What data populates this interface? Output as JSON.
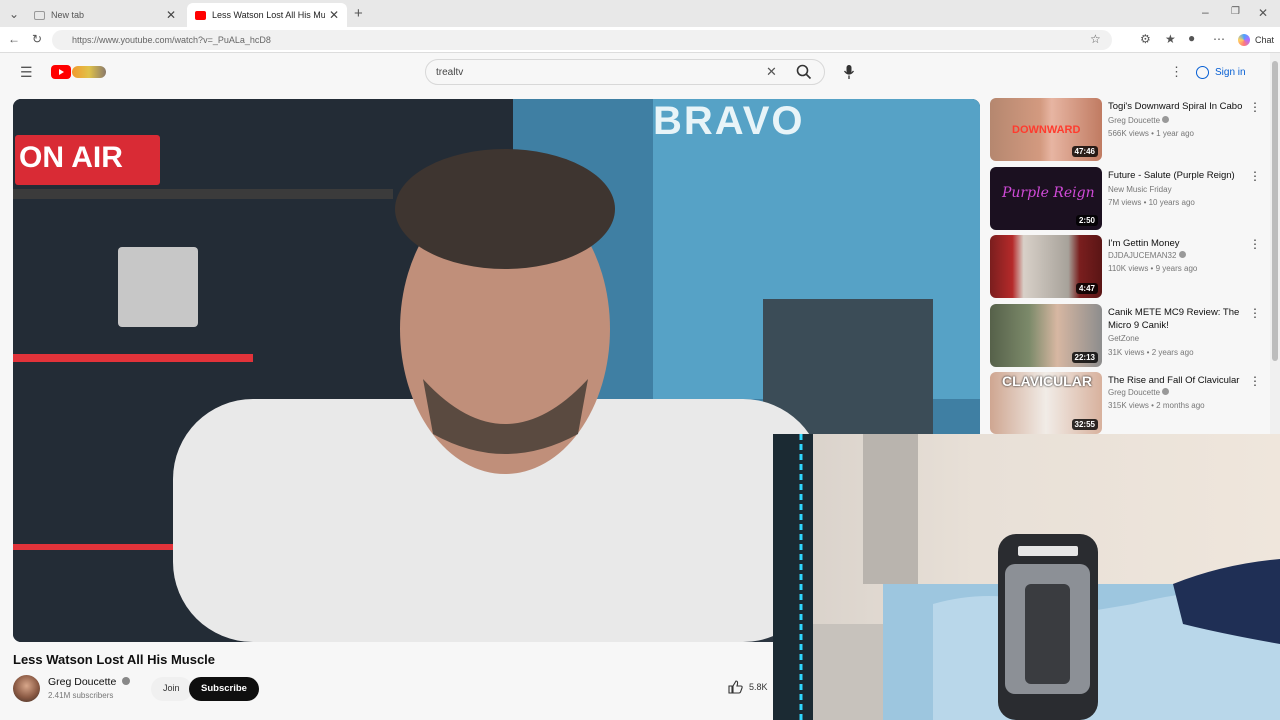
{
  "browser": {
    "tabs": [
      {
        "label": "New tab"
      },
      {
        "label": "Less Watson Lost All His Muscle - ..."
      }
    ],
    "url": "https://www.youtube.com/watch?v=_PuALa_hcD8",
    "chat_label": "Chat"
  },
  "header": {
    "search_value": "trealtv",
    "signin_label": "Sign in"
  },
  "video": {
    "title": "Less Watson Lost All His Muscle",
    "channel": "Greg Doucette",
    "subscribers": "2.41M subscribers",
    "join_label": "Join",
    "subscribe_label": "Subscribe",
    "likes": "5.8K",
    "overlay_sign": "ON AIR",
    "overlay_neon": "BRAVO"
  },
  "recommendations": [
    {
      "title": "Togi's Downward Spiral In Cabo",
      "channel": "Greg Doucette",
      "meta": "566K views • 1 year ago",
      "duration": "47:46",
      "verified": true,
      "thumb_text": "DOWNWARD"
    },
    {
      "title": "Future - Salute (Purple Reign)",
      "channel": "New Music Friday",
      "meta": "7M views • 10 years ago",
      "duration": "2:50",
      "verified": false,
      "thumb_text": "Purple Reign"
    },
    {
      "title": "I'm Gettin Money",
      "channel": "DJDAJUCEMAN32",
      "meta": "110K views • 9 years ago",
      "duration": "4:47",
      "verified": true,
      "thumb_text": ""
    },
    {
      "title": "Canik METE MC9 Review: The Micro 9 Canik!",
      "channel": "GetZone",
      "meta": "31K views • 2 years ago",
      "duration": "22:13",
      "verified": false,
      "thumb_text": ""
    },
    {
      "title": "The Rise and Fall Of Clavicular",
      "channel": "Greg Doucette",
      "meta": "315K views • 2 months ago",
      "duration": "32:55",
      "verified": true,
      "thumb_text": "CLAVICULAR"
    }
  ],
  "colors": {
    "youtube_red": "#ff0000",
    "link_blue": "#065fd4",
    "subscribe_bg": "#0f0f0f"
  }
}
